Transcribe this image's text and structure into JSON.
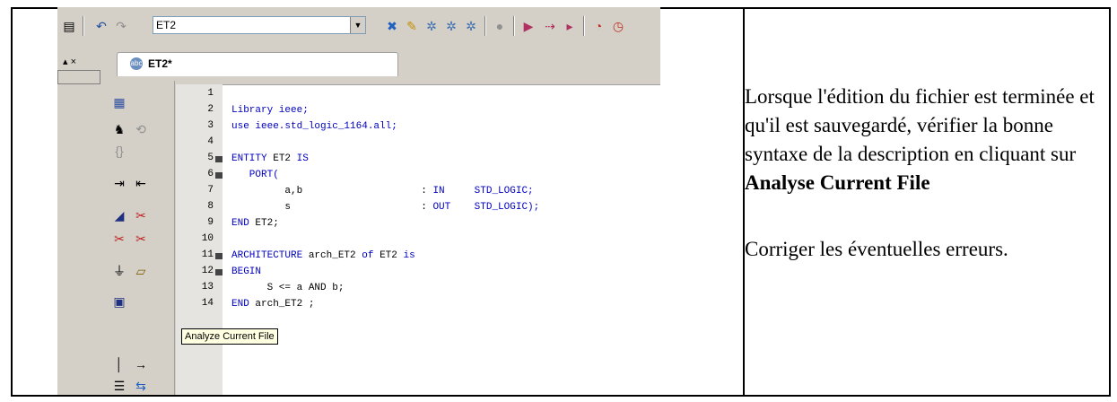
{
  "toolbar": {
    "combo_value": "ET2"
  },
  "tab": {
    "label": "ET2*",
    "icon": "abc"
  },
  "editor": {
    "line_numbers": [
      "1",
      "2",
      "3",
      "4",
      "5",
      "6",
      "7",
      "8",
      "9",
      "10",
      "11",
      "12",
      "13",
      "14"
    ],
    "lines": [
      {
        "n": "1",
        "parts": []
      },
      {
        "n": "2",
        "parts": [
          {
            "t": "Library ieee;",
            "c": "kw"
          }
        ]
      },
      {
        "n": "3",
        "parts": [
          {
            "t": "use ieee.std_logic_1164.all;",
            "c": "kw"
          }
        ]
      },
      {
        "n": "4",
        "parts": []
      },
      {
        "n": "5",
        "parts": [
          {
            "t": "ENTITY ",
            "c": "kw"
          },
          {
            "t": "ET2 ",
            "c": "tx"
          },
          {
            "t": "IS",
            "c": "kw"
          }
        ]
      },
      {
        "n": "6",
        "parts": [
          {
            "t": "   PORT(",
            "c": "kw"
          }
        ]
      },
      {
        "n": "7",
        "parts": [
          {
            "t": "         a,b                    : ",
            "c": "tx"
          },
          {
            "t": "IN     STD_LOGIC;",
            "c": "kw"
          }
        ]
      },
      {
        "n": "8",
        "parts": [
          {
            "t": "         s                      : ",
            "c": "tx"
          },
          {
            "t": "OUT    STD_LOGIC);",
            "c": "kw"
          }
        ]
      },
      {
        "n": "9",
        "parts": [
          {
            "t": "END ",
            "c": "kw"
          },
          {
            "t": "ET2;",
            "c": "tx"
          }
        ]
      },
      {
        "n": "10",
        "parts": []
      },
      {
        "n": "11",
        "parts": [
          {
            "t": "ARCHITECTURE ",
            "c": "kw"
          },
          {
            "t": "arch_ET2 ",
            "c": "tx"
          },
          {
            "t": "of ",
            "c": "kw"
          },
          {
            "t": "ET2 ",
            "c": "tx"
          },
          {
            "t": "is",
            "c": "kw"
          }
        ]
      },
      {
        "n": "12",
        "parts": [
          {
            "t": "BEGIN",
            "c": "kw"
          }
        ]
      },
      {
        "n": "13",
        "parts": [
          {
            "t": "      S <= a AND b;",
            "c": "tx"
          }
        ]
      },
      {
        "n": "14",
        "parts": [
          {
            "t": "END ",
            "c": "kw"
          },
          {
            "t": "arch_ET2 ;",
            "c": "tx"
          }
        ]
      }
    ]
  },
  "tooltip": "Analyze Current File",
  "note": {
    "para1_a": "Lorsque l'édition du fichier est terminée et qu'il est sauvegardé, vérifier la bonne syntaxe de la description en cliquant sur ",
    "para1_bold": "Analyse Current File",
    "para2": "Corriger les éventuelles erreurs."
  }
}
